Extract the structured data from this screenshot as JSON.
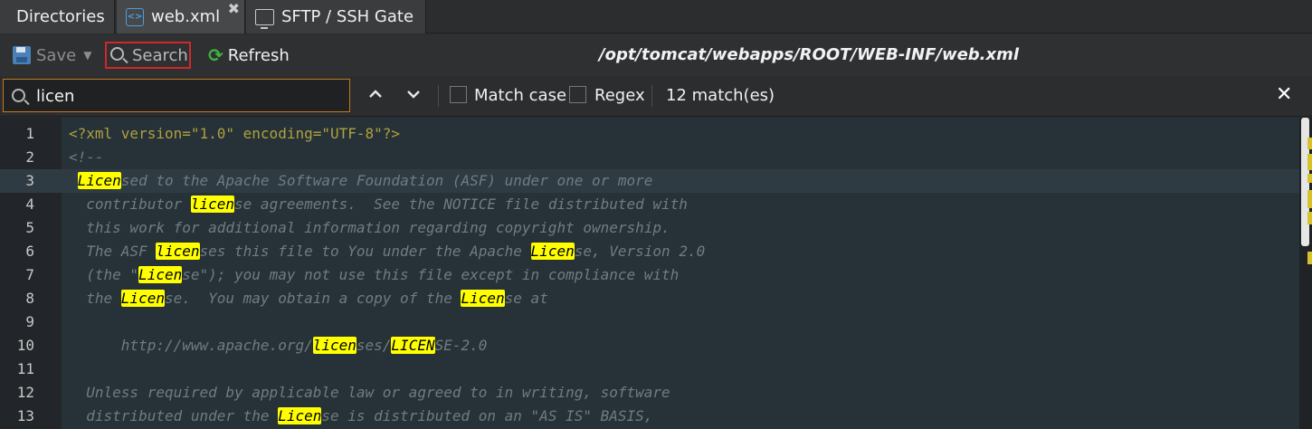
{
  "tabs": [
    {
      "label": "Directories"
    },
    {
      "label": "web.xml",
      "icon": "xml-file-icon"
    },
    {
      "label": "SFTP / SSH Gate",
      "icon": "terminal-icon"
    }
  ],
  "toolbar": {
    "save_label": "Save",
    "search_label": "Search",
    "refresh_label": "Refresh",
    "file_path": "/opt/tomcat/webapps/ROOT/WEB-INF/web.xml"
  },
  "search": {
    "query": "licen",
    "match_case_label": "Match case",
    "regex_label": "Regex",
    "match_count": "12 match(es)"
  },
  "editor": {
    "lines": [
      {
        "n": "1",
        "text": "<?xml version=\"1.0\" encoding=\"UTF-8\"?>"
      },
      {
        "n": "2",
        "text": "<!--"
      },
      {
        "n": "3",
        "text": " Licensed to the Apache Software Foundation (ASF) under one or more"
      },
      {
        "n": "4",
        "text": "  contributor license agreements.  See the NOTICE file distributed with"
      },
      {
        "n": "5",
        "text": "  this work for additional information regarding copyright ownership."
      },
      {
        "n": "6",
        "text": "  The ASF licenses this file to You under the Apache License, Version 2.0"
      },
      {
        "n": "7",
        "text": "  (the \"License\"); you may not use this file except in compliance with"
      },
      {
        "n": "8",
        "text": "  the License.  You may obtain a copy of the License at"
      },
      {
        "n": "9",
        "text": ""
      },
      {
        "n": "10",
        "text": "      http://www.apache.org/licenses/LICENSE-2.0"
      },
      {
        "n": "11",
        "text": ""
      },
      {
        "n": "12",
        "text": "  Unless required by applicable law or agreed to in writing, software"
      },
      {
        "n": "13",
        "text": "  distributed under the License is distributed on an \"AS IS\" BASIS,"
      }
    ],
    "active_line": 3
  },
  "colors": {
    "highlight": "#ffff00",
    "search_focus_border": "#c47a1e",
    "search_button_outline": "#d02828",
    "refresh_icon": "#42b040"
  }
}
